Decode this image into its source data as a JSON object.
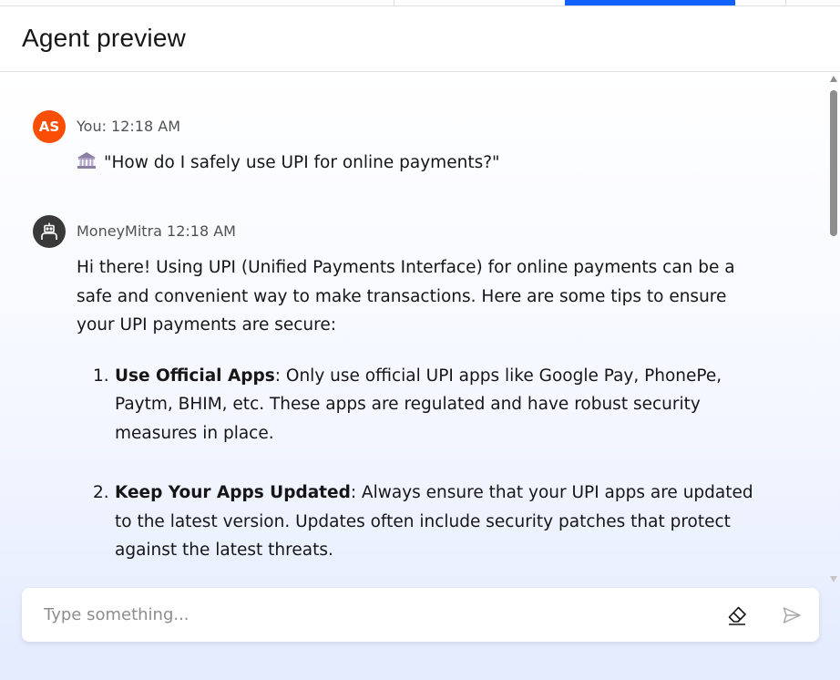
{
  "header": {
    "title": "Agent preview"
  },
  "messages": {
    "user": {
      "initials": "AS",
      "meta": "You: 12:18 AM",
      "text": "\"How do I safely use UPI for online payments?\"",
      "icon": "bank-icon"
    },
    "bot": {
      "meta": "MoneyMitra 12:18 AM",
      "icon": "robot-icon",
      "intro": "Hi there! Using UPI (Unified Payments Interface) for online payments can be a safe and convenient way to make transactions. Here are some tips to ensure your UPI payments are secure:",
      "tips": [
        {
          "num": "1.",
          "title": "Use Official Apps",
          "text": ": Only use official UPI apps like Google Pay, PhonePe, Paytm, BHIM, etc. These apps are regulated and have robust security measures in place."
        },
        {
          "num": "2.",
          "title": "Keep Your Apps Updated",
          "text": ": Always ensure that your UPI apps are updated to the latest version. Updates often include security patches that protect against the latest threats."
        }
      ]
    }
  },
  "composer": {
    "placeholder": "Type something...",
    "clear_icon": "eraser-icon",
    "send_icon": "send-icon"
  },
  "colors": {
    "accent": "#0f62fe",
    "user_avatar": "#fa4d06",
    "bot_avatar": "#393939"
  }
}
